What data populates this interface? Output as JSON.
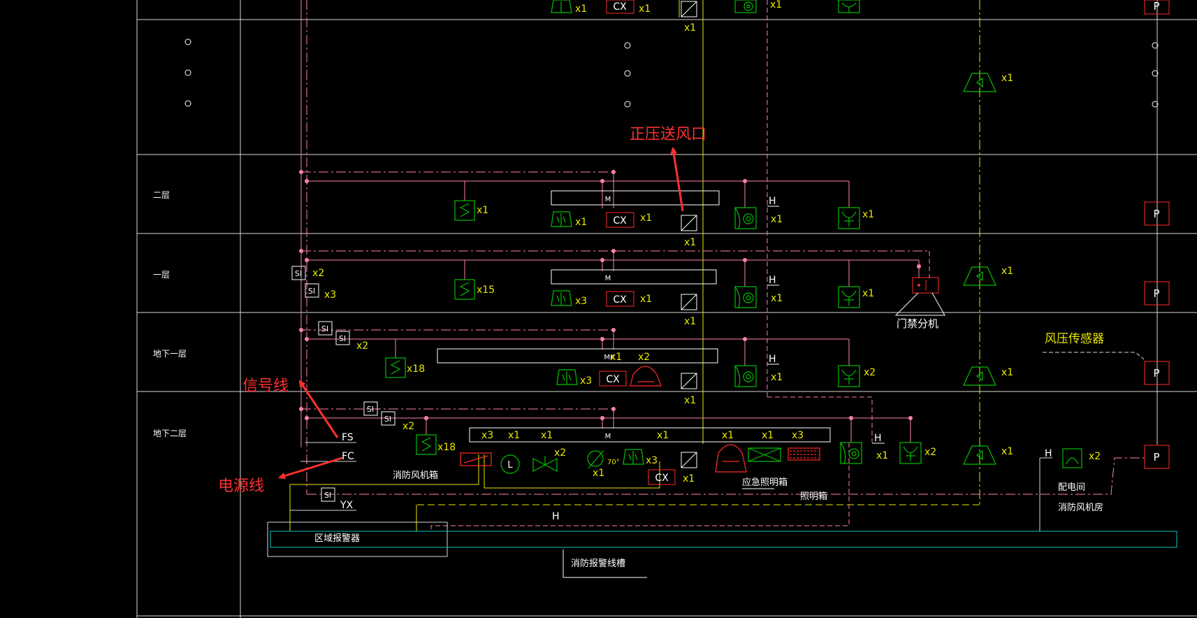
{
  "floors": [
    {
      "label": "二层"
    },
    {
      "label": "一层"
    },
    {
      "label": "地下一层"
    },
    {
      "label": "地下二层"
    }
  ],
  "annotations": {
    "positive_pressure_vent": "正压送风口",
    "signal_line": "信号线",
    "power_line": "电源线",
    "access_control": "门禁分机",
    "wind_pressure_sensor": "风压传感器"
  },
  "equipment_labels": {
    "fire_fan_box": "消防风机箱",
    "emergency_lighting_box": "应急照明箱",
    "lighting_box": "照明箱",
    "zone_alarm": "区域报警器",
    "fire_alarm_trunking": "消防报警线槽",
    "distribution_room": "配电间",
    "fire_fan_room": "消防风机房"
  },
  "bus_labels": {
    "fs": "FS",
    "fc": "FC",
    "yx": "YX"
  },
  "symbols": {
    "m": "M",
    "cx": "CX",
    "p": "P",
    "si": "SI",
    "h": "H",
    "l": "L",
    "t70": "70°",
    "mk": "MK"
  },
  "top_row_counts": {
    "ac": "x1",
    "cx": "x1",
    "vent": "x1",
    "smoke": "x1",
    "phone": "x1",
    "speaker": "x1"
  },
  "floor2_counts": {
    "sensor": "x1",
    "ac": "x1",
    "cx": "x1",
    "vent": "x1",
    "smoke": "x1",
    "phone": "x1"
  },
  "floor1_counts": {
    "si1": "x2",
    "si2": "x3",
    "sensor": "x15",
    "ac": "x3",
    "cx": "x1",
    "vent": "x1",
    "smoke": "x1",
    "phone": "x1",
    "speaker": "x1"
  },
  "b1_counts": {
    "si": "x2",
    "sensor": "x18",
    "mk": "x1",
    "alarm": "x2",
    "ac": "x3",
    "vent": "x1",
    "smoke": "x1",
    "phone": "x2",
    "speaker": "x1"
  },
  "b2_counts": {
    "si": "x2",
    "sensor": "x18",
    "x3a": "x3",
    "x1a": "x1",
    "x1b": "x1",
    "valve": "x2",
    "t70": "x1",
    "ac": "x3",
    "x1c": "x1",
    "cx": "x1",
    "vent": "x1",
    "x1d": "x1",
    "x1e": "x1",
    "x3b": "x3",
    "smoke": "x1",
    "phone": "x2",
    "speaker": "x1",
    "horn": "x2"
  },
  "colors": {
    "white": "#ffffff",
    "magenta": "#ff7fae",
    "yellow": "#e8e800",
    "green": "#00c000",
    "red": "#ff2a2a",
    "cyan": "#00c8c8",
    "annotation": "#ff3030"
  }
}
